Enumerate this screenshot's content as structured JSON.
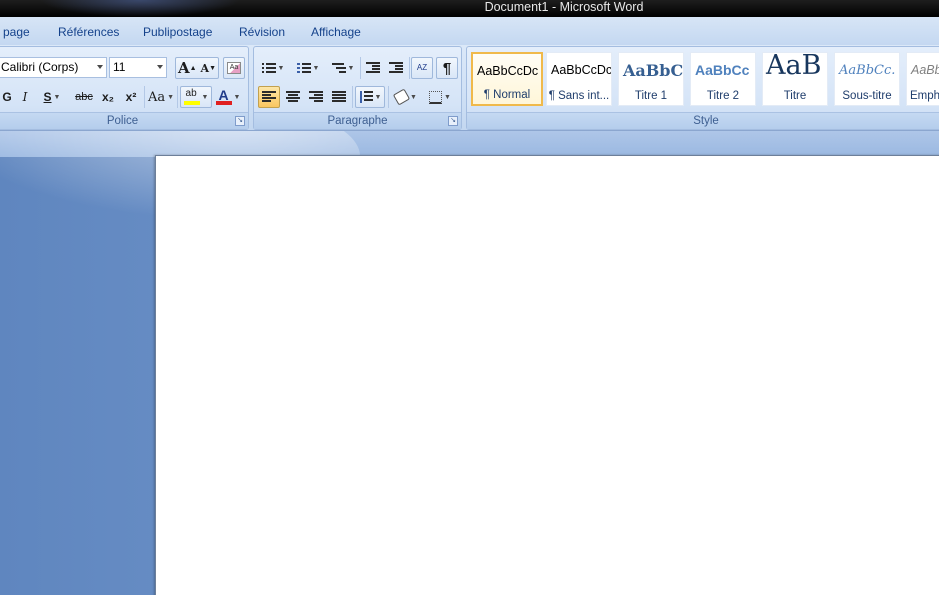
{
  "window": {
    "title": "Document1 - Microsoft Word"
  },
  "tabs": [
    {
      "label": "page"
    },
    {
      "label": "Références"
    },
    {
      "label": "Publipostage"
    },
    {
      "label": "Révision"
    },
    {
      "label": "Affichage"
    }
  ],
  "font_group": {
    "label": "Police",
    "font_name": "Calibri (Corps)",
    "font_size": "11",
    "grow_label": "A",
    "shrink_label": "A",
    "bold_label": "G",
    "italic_label": "I",
    "underline_label": "S",
    "strike_label": "abc",
    "subscript_label": "x₂",
    "superscript_label": "x²",
    "case_label": "Aa",
    "highlight_label": "ab",
    "font_color_label": "A"
  },
  "paragraph_group": {
    "label": "Paragraphe",
    "sort_label": "AZ",
    "pilcrow_label": "¶"
  },
  "style_group": {
    "label": "Style",
    "items": [
      {
        "sample": "AaBbCcDc",
        "name": "¶ Normal"
      },
      {
        "sample": "AaBbCcDc",
        "name": "¶ Sans int..."
      },
      {
        "sample": "AaBbCc",
        "name": "Titre 1"
      },
      {
        "sample": "AaBbCc",
        "name": "Titre 2"
      },
      {
        "sample": "AaB",
        "name": "Titre"
      },
      {
        "sample": "AaBbCc.",
        "name": "Sous-titre"
      },
      {
        "sample": "AaBbC",
        "name": "Emph"
      }
    ]
  },
  "colors": {
    "highlight": "#ffff00",
    "font_color": "#e02020",
    "heading": "#365f91",
    "accent_selected": "#f0b94a"
  }
}
